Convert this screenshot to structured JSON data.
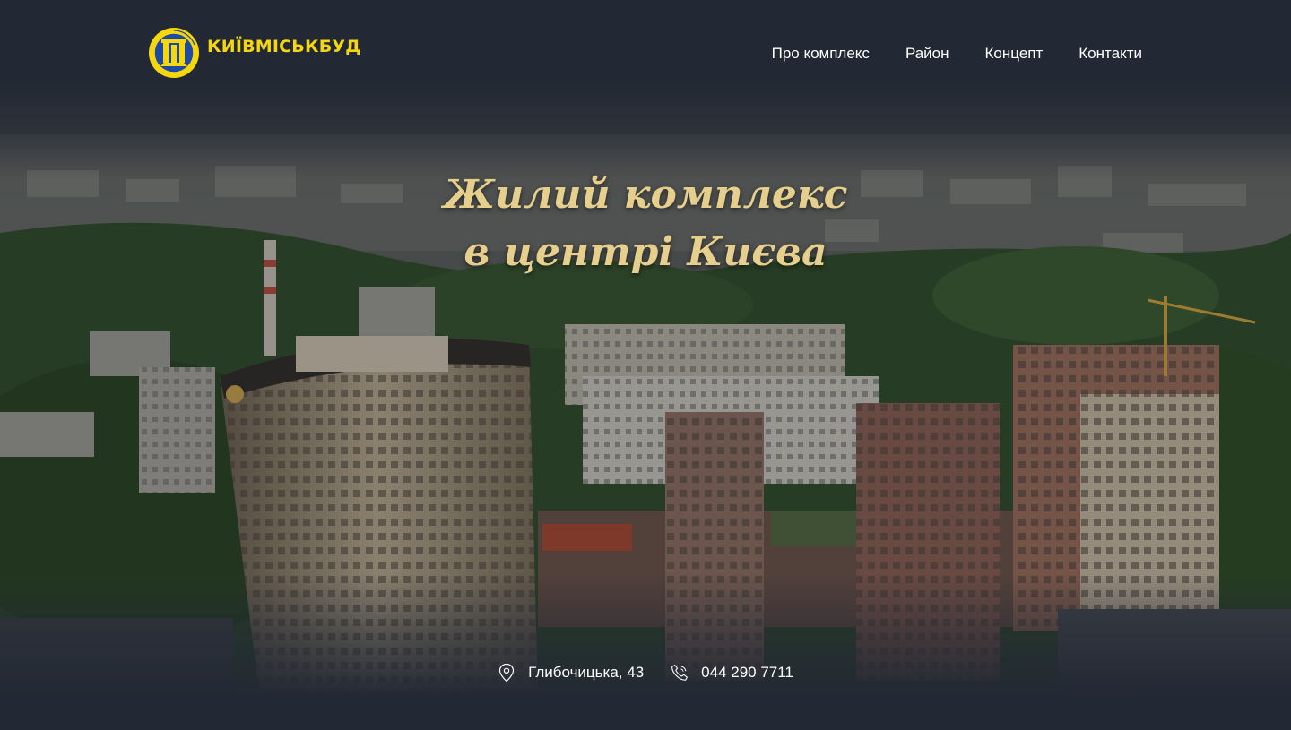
{
  "header": {
    "logo_text": "КИЇВМІСЬКБУД",
    "nav": [
      {
        "label": "Про комплекс"
      },
      {
        "label": "Район"
      },
      {
        "label": "Концепт"
      },
      {
        "label": "Контакти"
      }
    ]
  },
  "hero": {
    "title_line1": "Жилий комплекс",
    "title_line2": "в центрі Києва"
  },
  "contacts": {
    "address": "Глибочицька, 43",
    "phone": "044 290 7711"
  },
  "colors": {
    "background": "#232934",
    "logo_accent": "#f6d70c",
    "title": "#e6cf8c",
    "nav_text": "#ffffff"
  },
  "icons": {
    "address": "map-pin-icon",
    "phone": "phone-icon",
    "logo": "kyivmiskbud-emblem"
  }
}
